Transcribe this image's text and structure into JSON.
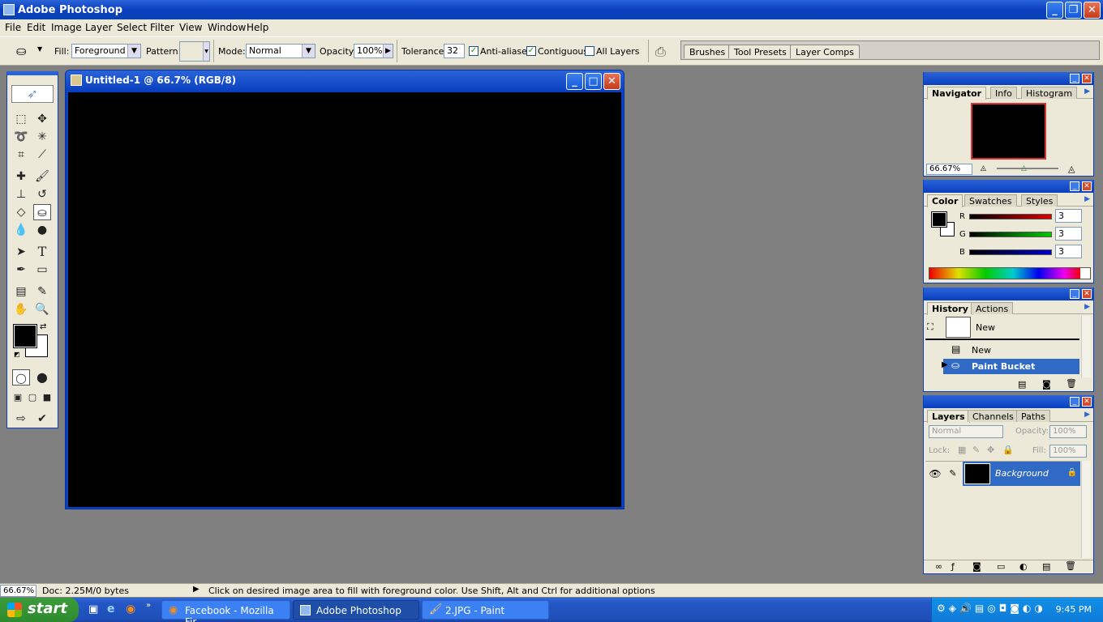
{
  "app": {
    "title": "Adobe Photoshop"
  },
  "menu": [
    "File",
    "Edit",
    "Image",
    "Layer",
    "Select",
    "Filter",
    "View",
    "Window",
    "Help"
  ],
  "options": {
    "fill_label": "Fill:",
    "fill_value": "Foreground",
    "pattern_label": "Pattern:",
    "mode_label": "Mode:",
    "mode_value": "Normal",
    "opacity_label": "Opacity:",
    "opacity_value": "100%",
    "tolerance_label": "Tolerance:",
    "tolerance_value": "32",
    "anti_aliased": "Anti-aliased",
    "contiguous": "Contiguous",
    "all_layers": "All Layers",
    "anti_aliased_checked": true,
    "contiguous_checked": true,
    "all_layers_checked": false
  },
  "palette_well": [
    "Brushes",
    "Tool Presets",
    "Layer Comps"
  ],
  "document": {
    "title": "Untitled-1 @ 66.7% (RGB/8)",
    "canvas_color": "#000000"
  },
  "navigator": {
    "tabs": [
      "Navigator",
      "Info",
      "Histogram"
    ],
    "zoom": "66.67%"
  },
  "color": {
    "tabs": [
      "Color",
      "Swatches",
      "Styles"
    ],
    "r_label": "R",
    "g_label": "G",
    "b_label": "B",
    "r": "3",
    "g": "3",
    "b": "3"
  },
  "history": {
    "tabs": [
      "History",
      "Actions"
    ],
    "snapshot": "New",
    "items": [
      "New",
      "Paint Bucket"
    ]
  },
  "layers": {
    "tabs": [
      "Layers",
      "Channels",
      "Paths"
    ],
    "blend": "Normal",
    "opacity_label": "Opacity:",
    "opacity": "100%",
    "lock_label": "Lock:",
    "fill_label": "Fill:",
    "fill": "100%",
    "layer_name": "Background"
  },
  "status": {
    "zoom": "66.67%",
    "doc": "Doc: 2.25M/0 bytes",
    "hint": "Click on desired image area to fill with foreground color.  Use Shift, Alt and Ctrl for additional options"
  },
  "taskbar": {
    "start": "start",
    "items": [
      "Facebook - Mozilla Fir...",
      "Adobe Photoshop",
      "2.JPG - Paint"
    ],
    "time": "9:45 PM"
  }
}
